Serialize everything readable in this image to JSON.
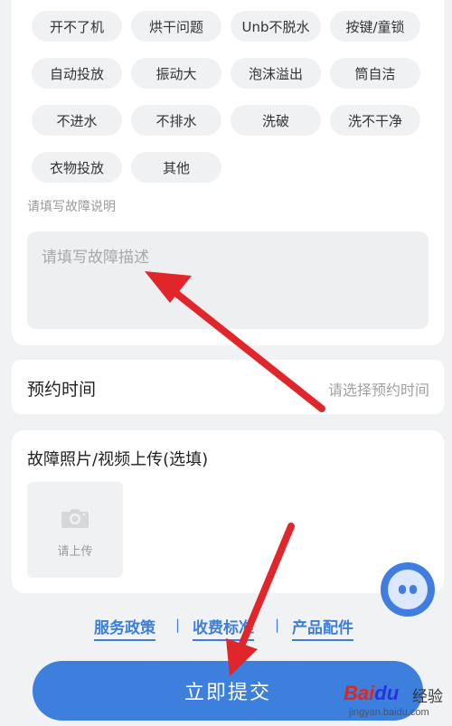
{
  "fault_types": [
    [
      "开不了机",
      "烘干问题",
      "Unb不脱水",
      "按键/童锁"
    ],
    [
      "自动投放",
      "振动大",
      "泡沫溢出",
      "筒自洁"
    ],
    [
      "不进水",
      "不排水",
      "洗破",
      "洗不干净"
    ],
    [
      "衣物投放",
      "其他"
    ]
  ],
  "description": {
    "hint": "请填写故障说明",
    "placeholder": "请填写故障描述",
    "value": ""
  },
  "appointment": {
    "label": "预约时间",
    "placeholder": "请选择预约时间"
  },
  "upload": {
    "title": "故障照片/视频上传(选填)",
    "button_label": "请上传",
    "icon": "camera-icon"
  },
  "footer_links": {
    "service_policy": "服务政策",
    "fee_standard": "收费标准",
    "product_parts": "产品配件",
    "separator": "|"
  },
  "submit": {
    "label": "立即提交"
  },
  "assistant": {
    "icon": "robot-assistant-icon"
  },
  "watermark": {
    "logo_bai": "Bai",
    "logo_du": "du",
    "jingyan": "经验",
    "url": "jingyan.baidu.com"
  },
  "colors": {
    "accent": "#3c7fdc",
    "chip_bg": "#f0f1f3",
    "annotation_arrow": "#e0262b"
  }
}
